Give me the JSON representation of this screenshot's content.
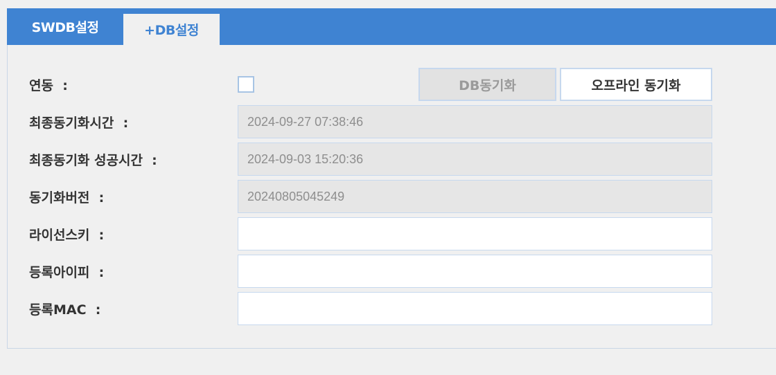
{
  "tabs": [
    {
      "label": "SWDB설정",
      "active": false
    },
    {
      "label": "+DB설정",
      "active": true
    }
  ],
  "link": {
    "label": "연동  :",
    "checked": false
  },
  "buttons": {
    "db_sync": "DB동기화",
    "offline_sync": "오프라인 동기화"
  },
  "fields": {
    "last_sync_time": {
      "label": "최종동기화시간  :",
      "value": "2024-09-27 07:38:46"
    },
    "last_sync_success_time": {
      "label": "최종동기화 성공시간  :",
      "value": "2024-09-03 15:20:36"
    },
    "sync_version": {
      "label": "동기화버전  :",
      "value": "20240805045249"
    },
    "license_key": {
      "label": "라이선스키  :",
      "value": ""
    },
    "registered_ip": {
      "label": "등록아이피  :",
      "value": ""
    },
    "registered_mac": {
      "label": "등록MAC  :",
      "value": ""
    }
  },
  "colors": {
    "accent": "#3f83d2",
    "border": "#c6d8ee",
    "readonly_bg": "#e6e6e6"
  }
}
